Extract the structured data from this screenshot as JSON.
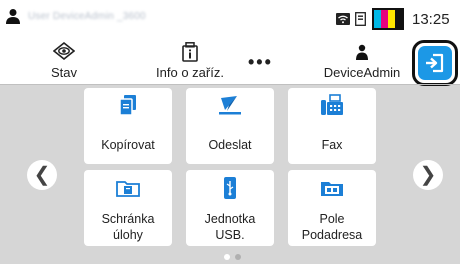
{
  "status_bar": {
    "user_name": "User DeviceAdmin _3600",
    "time": "13:25",
    "toner_colors": [
      "#00b8e6",
      "#e6007e",
      "#ffe600",
      "#111111"
    ]
  },
  "nav": {
    "status_label": "Stav",
    "device_info_label": "Info o zaříz.",
    "more_label": "•••",
    "admin_label": "DeviceAdmin"
  },
  "tiles": [
    {
      "label_lines": [
        "Kopírovat"
      ],
      "icon": "copy-icon"
    },
    {
      "label_lines": [
        "Odeslat"
      ],
      "icon": "send-icon"
    },
    {
      "label_lines": [
        "Fax"
      ],
      "icon": "fax-icon"
    },
    {
      "label_lines": [
        "Schránka",
        "úlohy"
      ],
      "icon": "job-box-icon"
    },
    {
      "label_lines": [
        "Jednotka",
        "USB."
      ],
      "icon": "usb-drive-icon"
    },
    {
      "label_lines": [
        "Pole",
        "Podadresa"
      ],
      "icon": "subaddress-box-icon"
    }
  ],
  "pagination": {
    "pages": 2,
    "current": 1
  },
  "colors": {
    "accent": "#1c98e6",
    "icon_blue": "#1c7fd6",
    "background": "#d6d6d6"
  }
}
